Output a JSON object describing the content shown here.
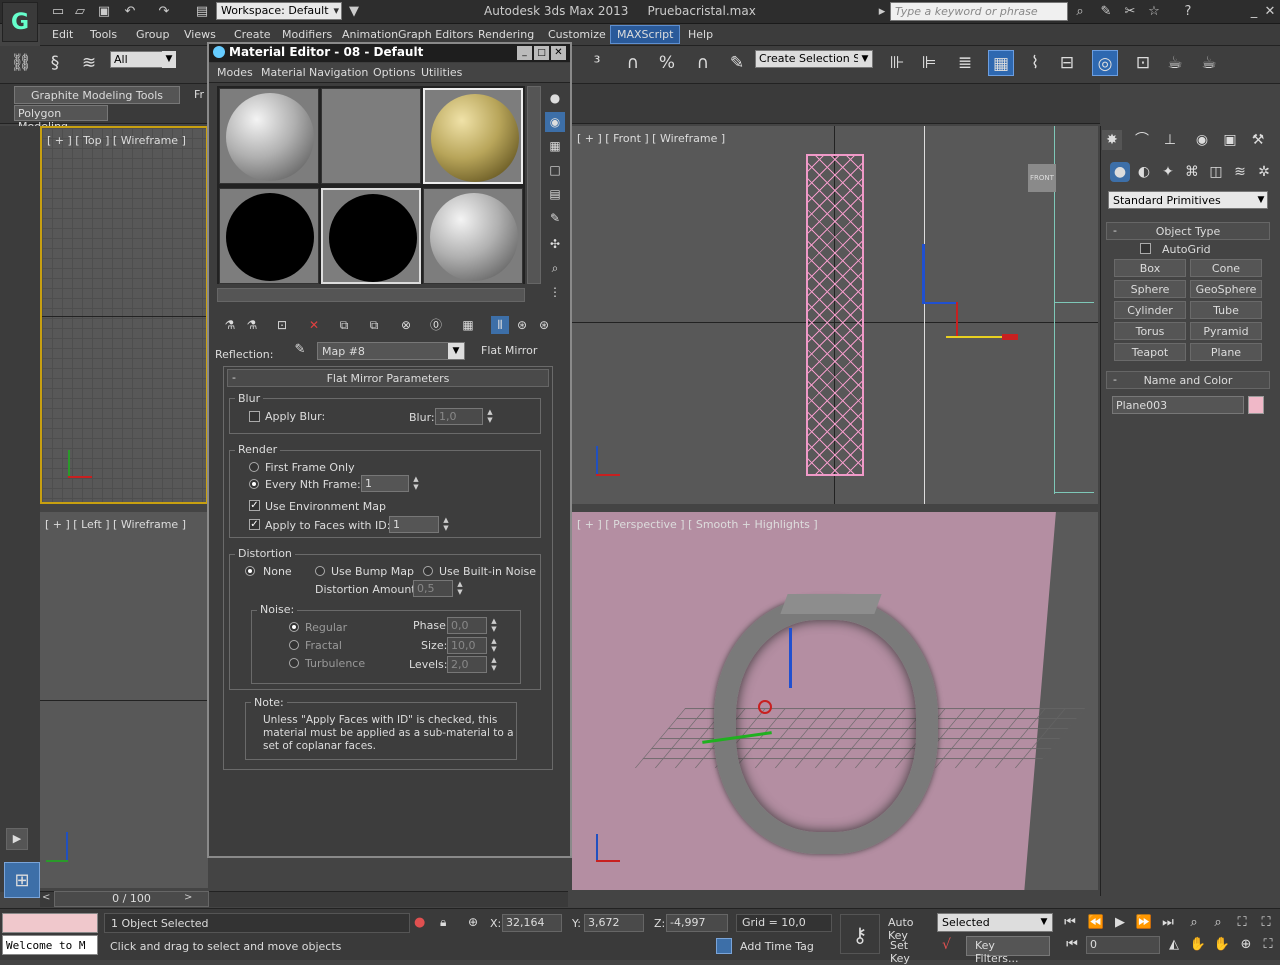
{
  "titlebar": {
    "workspace": "Workspace: Default",
    "app": "Autodesk 3ds Max  2013",
    "file": "Pruebacristal.max",
    "search_placeholder": "Type a keyword or phrase"
  },
  "menus": [
    "Edit",
    "Tools",
    "Group",
    "Views",
    "Create",
    "Modifiers",
    "Animation",
    "Graph Editors",
    "Rendering",
    "Customize",
    "MAXScript",
    "Help"
  ],
  "toolbar": {
    "filter": "All",
    "selection_set": "Create Selection Se"
  },
  "ribbon": {
    "tab1": "Graphite Modeling Tools",
    "tab2": "Fr",
    "tab3": "Polygon Modeling"
  },
  "viewports": {
    "top": "[ + ] [ Top ] [ Wireframe ]",
    "front": "[ + ] [ Front ] [ Wireframe ]",
    "left": "[ + ] [ Left ] [ Wireframe ]",
    "persp": "[ + ] [ Perspective ] [ Smooth + Highlights ]",
    "viewcube_front": "FRONT"
  },
  "cmdpanel": {
    "category": "Standard Primitives",
    "object_type": "Object Type",
    "autogrid": "AutoGrid",
    "buttons": [
      "Box",
      "Cone",
      "Sphere",
      "GeoSphere",
      "Cylinder",
      "Tube",
      "Torus",
      "Pyramid",
      "Teapot",
      "Plane"
    ],
    "name_and_color": "Name and Color",
    "object_name": "Plane003",
    "color": "#f0b8c8"
  },
  "mated": {
    "title": "Material Editor - 08 - Default",
    "menu": [
      "Modes",
      "Material",
      "Navigation",
      "Options",
      "Utilities"
    ],
    "reflection_label": "Reflection:",
    "map": "Map #8",
    "map_type": "Flat Mirror",
    "rollout": "Flat Mirror Parameters",
    "blur": {
      "group": "Blur",
      "apply": "Apply Blur:",
      "label": "Blur:",
      "value": "1,0"
    },
    "render": {
      "group": "Render",
      "first": "First Frame Only",
      "nth": "Every Nth Frame:",
      "nth_value": "1",
      "env": "Use Environment Map",
      "faces": "Apply to Faces with ID:",
      "faces_value": "1"
    },
    "distortion": {
      "group": "Distortion",
      "none": "None",
      "bump": "Use Bump Map",
      "noise": "Use Built-in Noise",
      "amount_label": "Distortion Amount:",
      "amount": "0,5"
    },
    "noise": {
      "group": "Noise:",
      "regular": "Regular",
      "fractal": "Fractal",
      "turbulence": "Turbulence",
      "phase_label": "Phase:",
      "phase": "0,0",
      "size_label": "Size:",
      "size": "10,0",
      "levels_label": "Levels:",
      "levels": "2,0"
    },
    "note": {
      "group": "Note:",
      "text": "Unless \"Apply Faces with ID\" is checked, this material must be applied as a sub-material to a set of coplanar faces."
    }
  },
  "timeline": {
    "position": "0 / 100"
  },
  "status": {
    "welcome": "Welcome to M",
    "selection": "1 Object Selected",
    "prompt": "Click and drag to select and move objects",
    "x_label": "X:",
    "x": "32,164",
    "y_label": "Y:",
    "y": "3,672",
    "z_label": "Z:",
    "z": "-4,997",
    "grid": "Grid = 10,0",
    "add_time_tag": "Add Time Tag",
    "auto_key": "Auto Key",
    "set_key": "Set Key",
    "key_mode": "Selected",
    "key_filters": "Key Filters...",
    "frame": "0"
  }
}
